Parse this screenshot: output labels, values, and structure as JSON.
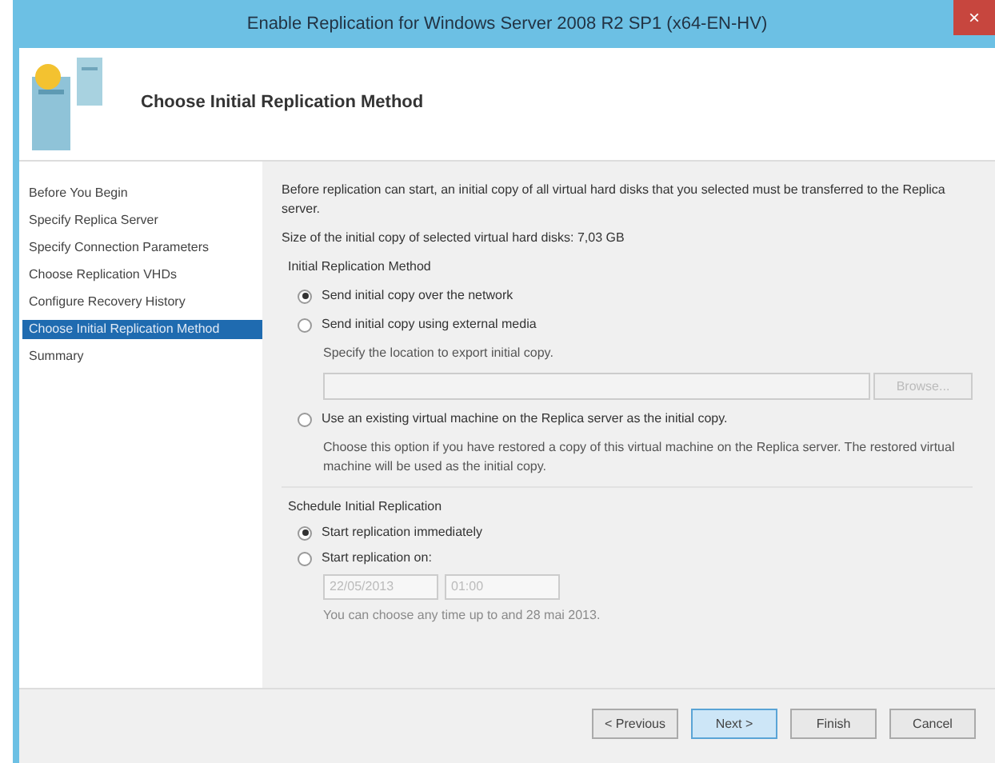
{
  "window": {
    "title": "Enable Replication for Windows Server 2008 R2 SP1 (x64-EN-HV)",
    "close": "×"
  },
  "header": {
    "title": "Choose Initial Replication Method"
  },
  "sidebar": {
    "items": [
      {
        "label": "Before You Begin",
        "selected": false
      },
      {
        "label": "Specify Replica Server",
        "selected": false
      },
      {
        "label": "Specify Connection Parameters",
        "selected": false
      },
      {
        "label": "Choose Replication VHDs",
        "selected": false
      },
      {
        "label": "Configure Recovery History",
        "selected": false
      },
      {
        "label": "Choose Initial Replication Method",
        "selected": true
      },
      {
        "label": "Summary",
        "selected": false
      }
    ]
  },
  "intro": "Before replication can start, an initial copy of all virtual hard disks that you selected must be transferred to the Replica server.",
  "size_line": "Size of the initial copy of selected virtual hard disks:  7,03 GB",
  "method": {
    "heading": "Initial Replication Method",
    "options": [
      {
        "label": "Send initial copy over the network",
        "selected": true
      },
      {
        "label": "Send initial copy using external media",
        "selected": false,
        "detail": "Specify the location to export initial copy.",
        "path_field": {
          "disabled": true
        },
        "browse": "Browse..."
      },
      {
        "label": "Use an existing virtual machine on the Replica server as the initial copy.",
        "selected": false,
        "detail": "Choose this option if you have restored a copy of this virtual machine on the Replica server. The restored virtual machine will be used as the initial copy."
      }
    ]
  },
  "schedule": {
    "heading": "Schedule Initial Replication",
    "options": [
      {
        "label": "Start replication immediately",
        "selected": true
      },
      {
        "label": "Start replication on:",
        "selected": false,
        "date": "22/05/2013",
        "time": "01:00",
        "hint": "You can choose any time up to and 28 mai 2013."
      }
    ]
  },
  "buttons": [
    {
      "label": "< Previous",
      "default": false
    },
    {
      "label": "Next >",
      "default": true
    },
    {
      "label": "Finish",
      "default": false
    },
    {
      "label": "Cancel",
      "default": false
    }
  ]
}
